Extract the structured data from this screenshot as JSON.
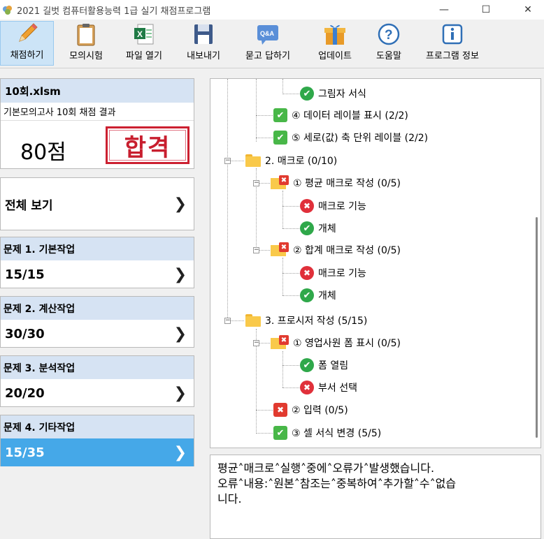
{
  "window": {
    "title": "2021 길벗 컴퓨터활용능력 1급 실기 채점프로그램",
    "minimize": "—",
    "maximize": "☐",
    "close": "✕"
  },
  "toolbar": {
    "items": [
      {
        "label": "채점하기",
        "icon": "pencil-icon",
        "active": true
      },
      {
        "label": "모의시험",
        "icon": "clipboard-icon"
      },
      {
        "label": "파일 열기",
        "icon": "excel-file-icon"
      },
      {
        "label": "내보내기",
        "icon": "save-icon"
      },
      {
        "label": "묻고 답하기",
        "icon": "qa-icon"
      },
      {
        "label": "업데이트",
        "icon": "gift-icon"
      },
      {
        "label": "도움말",
        "icon": "help-icon"
      },
      {
        "label": "프로그램 정보",
        "icon": "info-icon"
      }
    ],
    "qa_text": "Q&A"
  },
  "summary": {
    "file": "10회.xlsm",
    "subtitle": "기본모의고사 10회 채점 결과",
    "score": "80점",
    "result": "합격"
  },
  "view_all": {
    "label": "전체 보기",
    "chevron": "❯"
  },
  "problems": [
    {
      "title": "문제 1. 기본작업",
      "score": "15/15",
      "chevron": "❯"
    },
    {
      "title": "문제 2. 계산작업",
      "score": "30/30",
      "chevron": "❯"
    },
    {
      "title": "문제 3. 분석작업",
      "score": "20/20",
      "chevron": "❯"
    },
    {
      "title": "문제 4. 기타작업",
      "score": "15/35",
      "chevron": "❯",
      "active": true
    }
  ],
  "tree": {
    "nodes": [
      {
        "text": "그림자 서식",
        "icon": "ok"
      },
      {
        "text": "④ 데이터 레이블 표시 (2/2)",
        "icon": "sq-ok"
      },
      {
        "text": "⑤ 세로(값) 축 단위 레이블 (2/2)",
        "icon": "sq-ok"
      },
      {
        "text": "2. 매크로 (0/10)",
        "icon": "folder"
      },
      {
        "text": "① 평균 매크로 작성 (0/5)",
        "icon": "folder-x"
      },
      {
        "text": "매크로 기능",
        "icon": "x"
      },
      {
        "text": "개체",
        "icon": "ok"
      },
      {
        "text": "② 합계 매크로 작성 (0/5)",
        "icon": "folder-x"
      },
      {
        "text": "매크로 기능",
        "icon": "x"
      },
      {
        "text": "개체",
        "icon": "ok"
      },
      {
        "text": "3. 프로시저 작성 (5/15)",
        "icon": "folder"
      },
      {
        "text": "① 영업사원 폼 표시 (0/5)",
        "icon": "folder-x"
      },
      {
        "text": "폼 열림",
        "icon": "ok"
      },
      {
        "text": "부서 선택",
        "icon": "x"
      },
      {
        "text": "② 입력 (0/5)",
        "icon": "sq-x"
      },
      {
        "text": "③ 셀 서식 변경 (5/5)",
        "icon": "sq-ok"
      }
    ],
    "glyph_ok": "✔",
    "glyph_x": "✖",
    "glyph_minus": "−"
  },
  "message": {
    "line1": "평균˄매크로˄실행˄중에˄오류가˄발생했습니다.",
    "line2": "오류˄내용:˄원본˄참조는˄중복하여˄추가할˄수˄없습",
    "line3": "니다."
  }
}
